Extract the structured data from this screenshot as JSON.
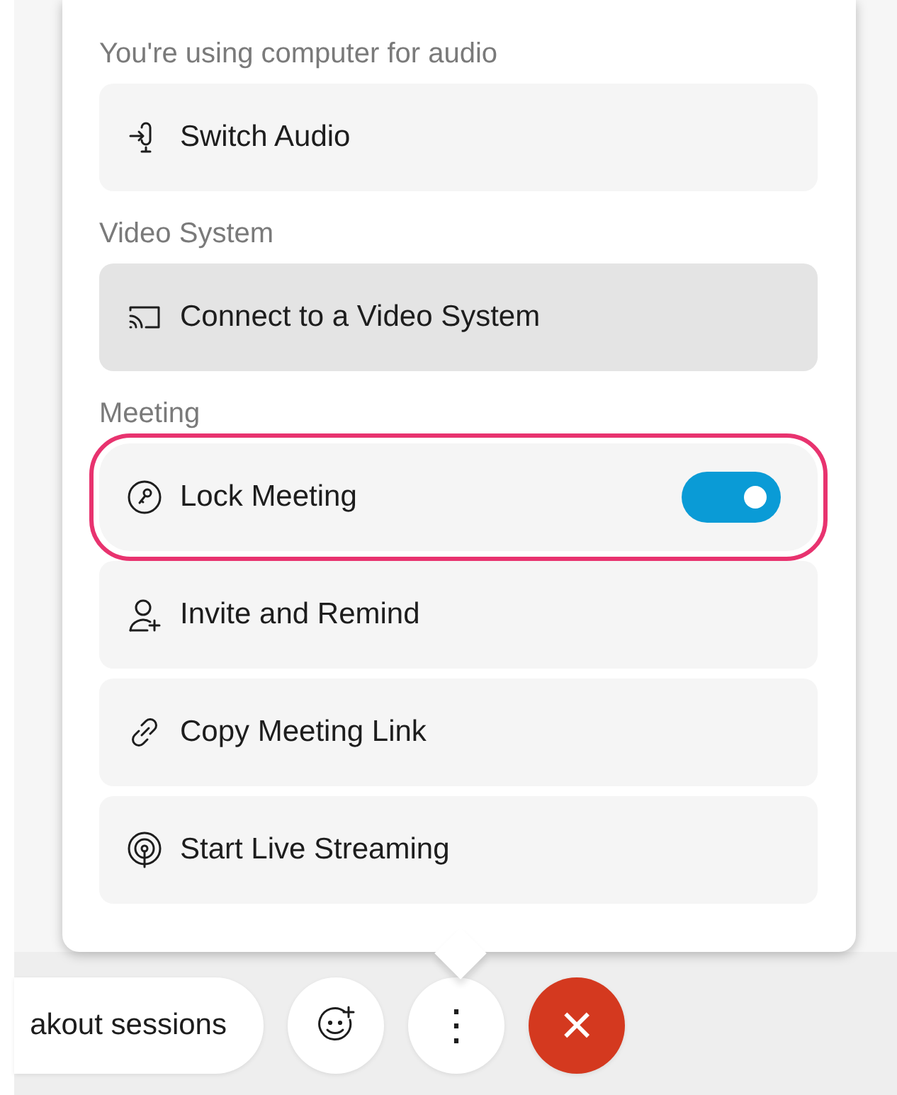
{
  "menu": {
    "sections": [
      {
        "header": "You're using computer for audio",
        "items": [
          {
            "kind": "action",
            "label": "Switch Audio",
            "hovered": false,
            "highlighted": false
          }
        ]
      },
      {
        "header": "Video System",
        "items": [
          {
            "kind": "action",
            "label": "Connect to a Video System",
            "hovered": true,
            "highlighted": false
          }
        ]
      },
      {
        "header": "Meeting",
        "items": [
          {
            "kind": "toggle",
            "label": "Lock Meeting",
            "on": true,
            "hovered": false,
            "highlighted": true
          },
          {
            "kind": "action",
            "label": "Invite and Remind",
            "hovered": false,
            "highlighted": false
          },
          {
            "kind": "action",
            "label": "Copy Meeting Link",
            "hovered": false,
            "highlighted": false
          },
          {
            "kind": "action",
            "label": "Start Live Streaming",
            "hovered": false,
            "highlighted": false
          }
        ]
      }
    ]
  },
  "controls": [
    {
      "kind": "pill",
      "label": "akout sessions"
    },
    {
      "kind": "reactions"
    },
    {
      "kind": "more",
      "label": "⋮"
    },
    {
      "kind": "leave",
      "label": "×"
    }
  ]
}
